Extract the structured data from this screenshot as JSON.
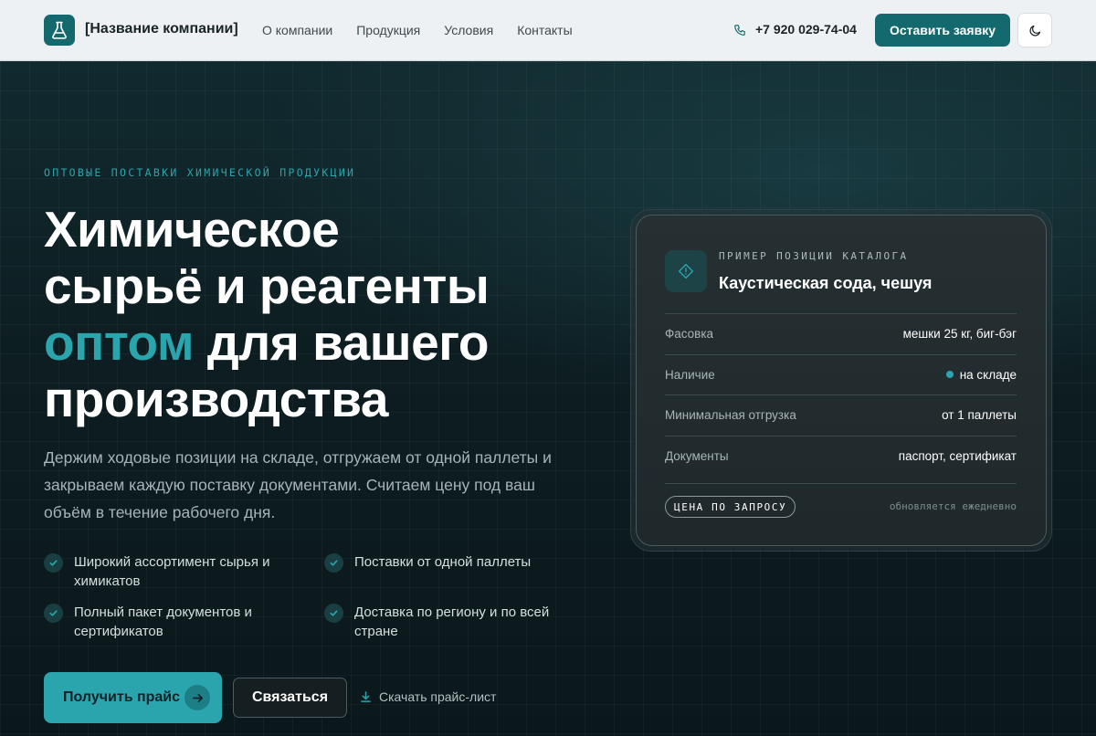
{
  "header": {
    "company": "[Название компании]",
    "nav": [
      "О компании",
      "Продукция",
      "Условия",
      "Контакты"
    ],
    "phone": "+7 920 029-74-04",
    "cta": "Оставить заявку"
  },
  "hero": {
    "eyebrow": "ОПТОВЫЕ ПОСТАВКИ ХИМИЧЕСКОЙ ПРОДУКЦИИ",
    "headline_line1": "Химическое",
    "headline_line2": "сырьё и реагенты",
    "headline_accent": "оптом",
    "headline_line3_rest": " для вашего",
    "headline_line4": "производства",
    "subtitle": "Держим ходовые позиции на складе, отгружаем от одной паллеты и закрываем каждую поставку документами. Считаем цену под ваш объём в течение рабочего дня.",
    "features": [
      "Широкий ассортимент сырья и химикатов",
      "Поставки от одной паллеты",
      "Полный пакет документов и сертификатов",
      "Доставка по региону и по всей стране"
    ],
    "primary_button": "Получить прайс",
    "secondary_button": "Связаться",
    "download_link": "Скачать прайс-лист"
  },
  "card": {
    "kicker": "ПРИМЕР ПОЗИЦИИ КАТАЛОГА",
    "title": "Каустическая сода, чешуя",
    "rows": [
      {
        "key": "Фасовка",
        "value": "мешки 25 кг, биг-бэг"
      },
      {
        "key": "Наличие",
        "value": "на складе"
      },
      {
        "key": "Минимальная отгрузка",
        "value": "от 1 паллеты"
      },
      {
        "key": "Документы",
        "value": "паспорт, сертификат"
      }
    ],
    "price_badge": "ЦЕНА ПО ЗАПРОСУ",
    "updated": "обновляется ежедневно"
  },
  "colors": {
    "accent": "#2aa5ad",
    "brand": "#14696e",
    "hero_bg": "#0d1c20",
    "header_bg": "#eef1f3"
  },
  "icons": [
    "flask-icon",
    "phone-icon",
    "moon-icon",
    "check-icon",
    "arrow-right-icon",
    "download-icon",
    "diamond-alert-icon"
  ]
}
